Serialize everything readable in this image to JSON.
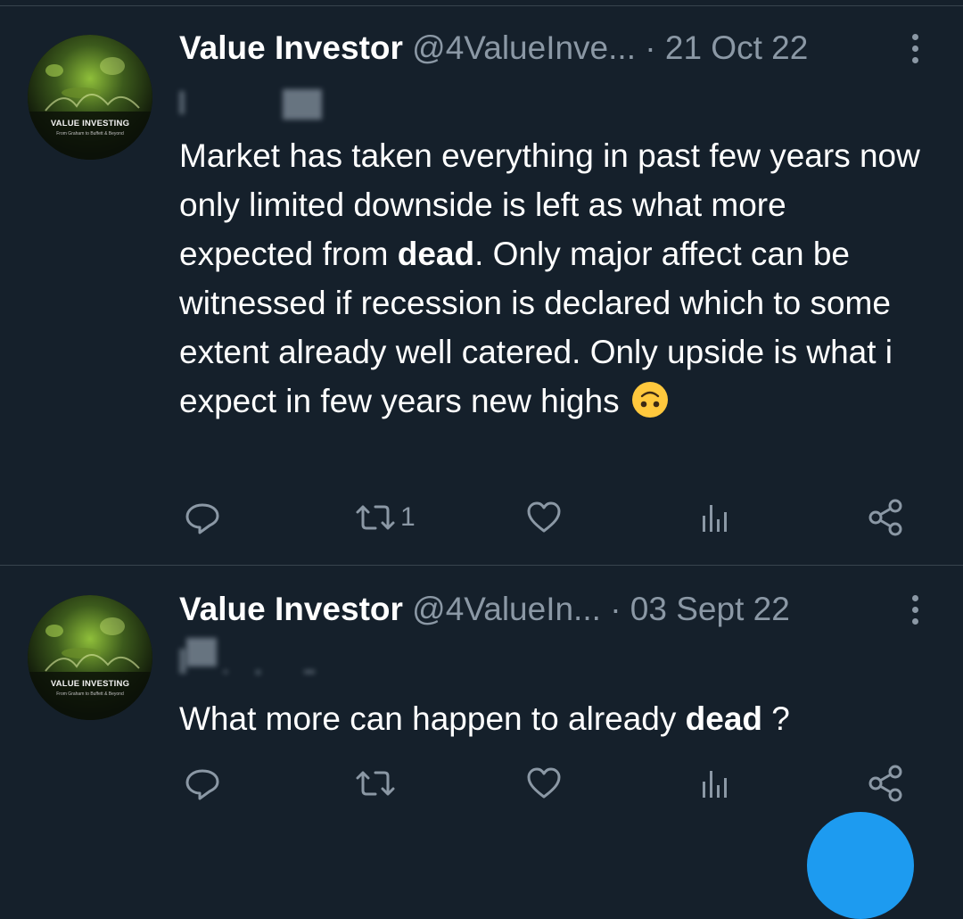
{
  "tweets": [
    {
      "author_name": "Value Investor",
      "handle": "@4ValueInve...",
      "separator": "·",
      "date": "21 Oct 22",
      "avatar": {
        "title": "VALUE INVESTING",
        "subtitle": "From Graham to Buffett & Beyond"
      },
      "body": {
        "part1": "Market has taken everything in past few years now only limited downside is left as what more expected from ",
        "bold": "dead",
        "part2": ". Only major affect can be witnessed if recession is declared which to some extent already well catered. Only upside is what i expect in few years new highs",
        "emoji": "upside-down-face"
      },
      "actions": {
        "reply_icon": "reply-icon",
        "retweet_icon": "retweet-icon",
        "retweet_count": "1",
        "like_icon": "heart-icon",
        "views_icon": "analytics-icon",
        "share_icon": "share-icon"
      }
    },
    {
      "author_name": "Value Investor",
      "handle": "@4ValueIn...",
      "separator": "·",
      "date": "03 Sept 22",
      "avatar": {
        "title": "VALUE INVESTING",
        "subtitle": "From Graham to Buffett & Beyond"
      },
      "body": {
        "part1": "What more can happen to already ",
        "bold": "dead",
        "part2": " ?"
      },
      "actions": {
        "reply_icon": "reply-icon",
        "retweet_icon": "retweet-icon",
        "like_icon": "heart-icon",
        "views_icon": "analytics-icon",
        "share_icon": "share-icon"
      }
    }
  ],
  "colors": {
    "background": "#15202b",
    "secondary_text": "#8b98a5",
    "divider": "#38444d",
    "accent": "#1d9bf0"
  }
}
